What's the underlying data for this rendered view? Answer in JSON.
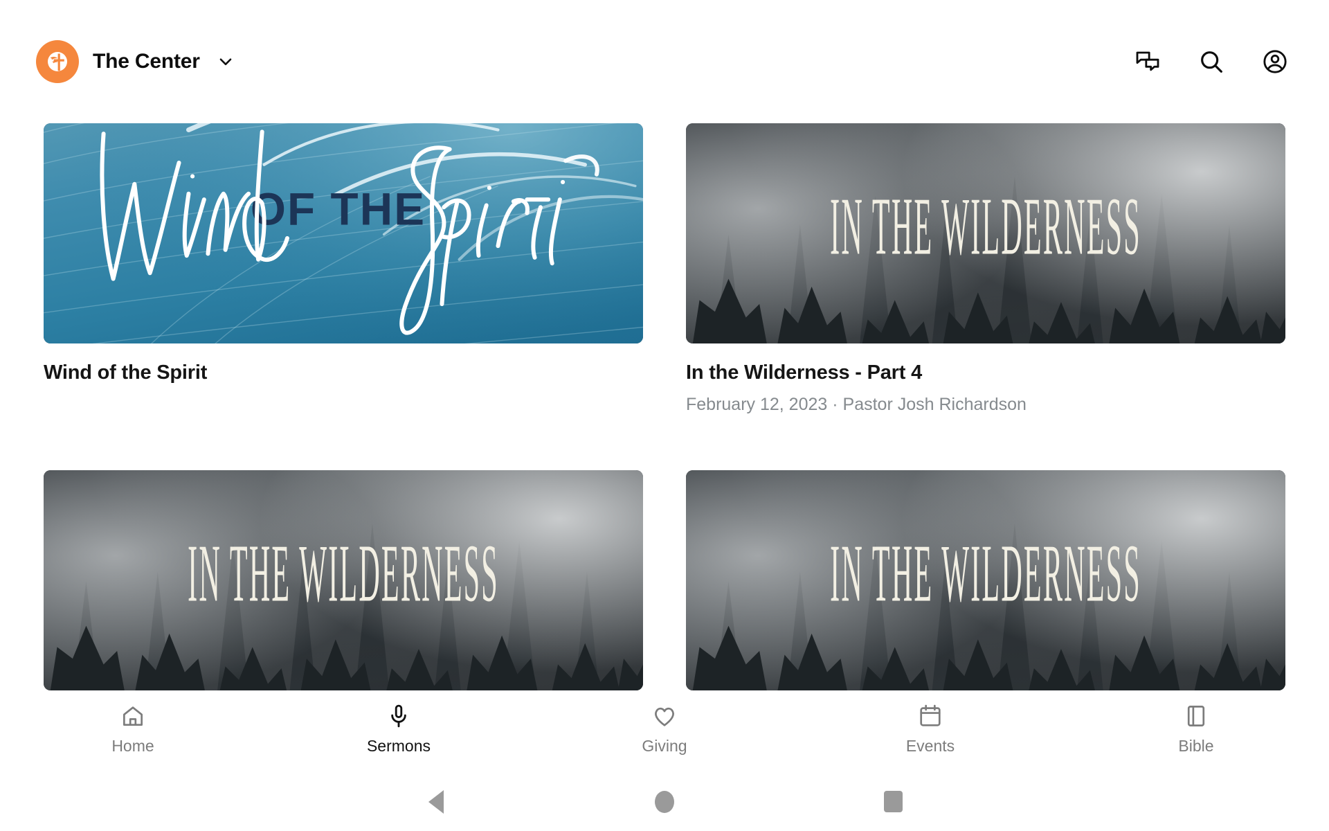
{
  "header": {
    "brand_name": "The Center",
    "logo_icon": "church-cross-logo",
    "chevron_icon": "chevron-down-icon",
    "actions": [
      {
        "icon": "chat-bubbles-icon",
        "name": "messages"
      },
      {
        "icon": "search-icon",
        "name": "search"
      },
      {
        "icon": "account-circle-icon",
        "name": "account"
      }
    ]
  },
  "main": {
    "cards": [
      {
        "title": "Wind of the Spirit",
        "subtitle": "",
        "artwork": "wind-of-the-spirit",
        "art_text_script_1": "Wind",
        "art_text_block": "OF THE",
        "art_text_script_2": "Spirit"
      },
      {
        "title": "In the Wilderness - Part 4",
        "subtitle": "February 12, 2023 · Pastor Josh Richardson",
        "artwork": "in-the-wilderness",
        "art_text_block": "IN THE WILDERNESS"
      },
      {
        "title": "",
        "subtitle": "",
        "artwork": "in-the-wilderness",
        "art_text_block": "IN THE WILDERNESS"
      },
      {
        "title": "",
        "subtitle": "",
        "artwork": "in-the-wilderness",
        "art_text_block": "IN THE WILDERNESS"
      }
    ]
  },
  "tabbar": {
    "items": [
      {
        "label": "Home",
        "icon": "home-icon",
        "active": false
      },
      {
        "label": "Sermons",
        "icon": "mic-icon",
        "active": true
      },
      {
        "label": "Giving",
        "icon": "heart-icon",
        "active": false
      },
      {
        "label": "Events",
        "icon": "calendar-icon",
        "active": false
      },
      {
        "label": "Bible",
        "icon": "book-icon",
        "active": false
      }
    ]
  },
  "system_nav": {
    "back": "back-triangle-icon",
    "home": "home-circle-icon",
    "recents": "recents-square-icon"
  },
  "colors": {
    "brand_orange": "#f5873d",
    "card_blue": "#2f80a6",
    "card_navy": "#1c3557",
    "text_primary": "#151515",
    "text_secondary": "#858a8e",
    "tab_inactive": "#7c7c7c",
    "tab_active": "#121212",
    "sysnav_gray": "#9a9a9a"
  }
}
